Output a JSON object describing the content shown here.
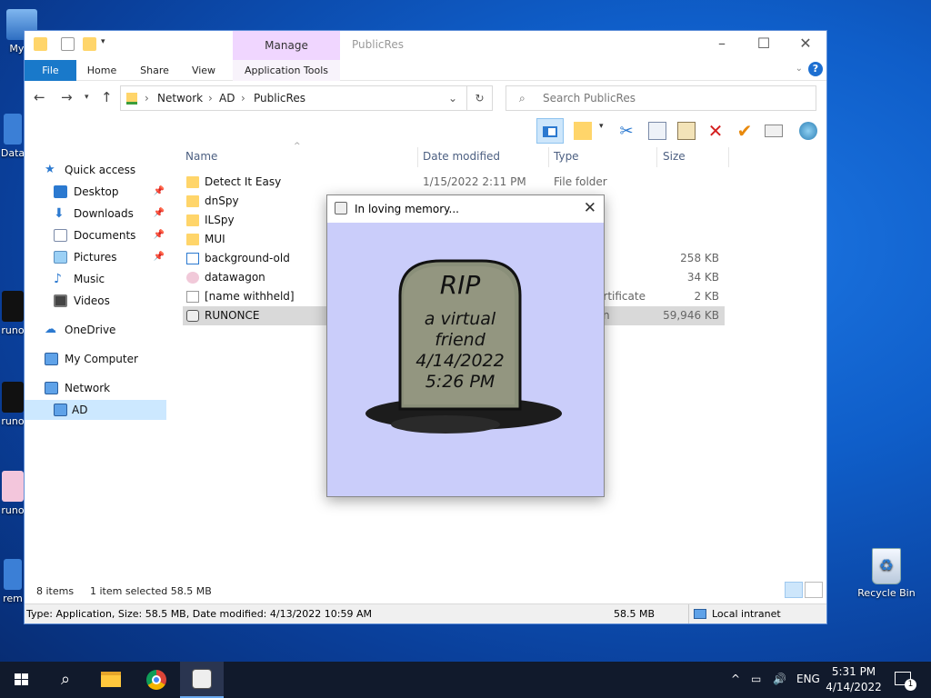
{
  "desktop": {
    "icons": [
      {
        "label": "My C"
      },
      {
        "label": "Data"
      },
      {
        "label": "runo"
      },
      {
        "label": "runo"
      },
      {
        "label": "runo"
      },
      {
        "label": "rem"
      },
      {
        "label": "Recycle Bin"
      }
    ]
  },
  "explorer": {
    "title": "PublicRes",
    "context_tab": "Manage",
    "tabs": [
      "File",
      "Home",
      "Share",
      "View",
      "Application Tools"
    ],
    "address": [
      "Network",
      "AD",
      "PublicRes"
    ],
    "search_placeholder": "Search PublicRes",
    "nav": {
      "quick_access": "Quick access",
      "pinned": [
        "Desktop",
        "Downloads",
        "Documents",
        "Pictures"
      ],
      "unpinned": [
        "Music",
        "Videos"
      ],
      "onedrive": "OneDrive",
      "my_computer": "My Computer",
      "network": "Network",
      "ad": "AD"
    },
    "columns": {
      "name": "Name",
      "date": "Date modified",
      "type": "Type",
      "size": "Size"
    },
    "files": [
      {
        "name": "Detect It Easy",
        "date": "1/15/2022 2:11 PM",
        "type": "File folder",
        "size": ""
      },
      {
        "name": "dnSpy",
        "date": "",
        "type": "",
        "size": ""
      },
      {
        "name": "ILSpy",
        "date": "",
        "type": "",
        "size": ""
      },
      {
        "name": "MUI",
        "date": "",
        "type": "",
        "size": ""
      },
      {
        "name": "background-old",
        "date": "",
        "type": "",
        "size": "258 KB"
      },
      {
        "name": "datawagon",
        "date": "",
        "type": "",
        "size": "34 KB"
      },
      {
        "name": "[name withheld]",
        "date": "",
        "type": "ertificate",
        "size": "2 KB"
      },
      {
        "name": "RUNONCE",
        "date": "",
        "type": "n",
        "size": "59,946 KB"
      }
    ],
    "status": {
      "count": "8 items",
      "selection": "1 item selected  58.5 MB"
    },
    "details": {
      "text": "Type: Application, Size: 58.5 MB, Date modified: 4/13/2022 10:59 AM",
      "size": "58.5 MB",
      "zone": "Local intranet"
    }
  },
  "dialog": {
    "title": "In loving memory...",
    "stone_lines": [
      "RIP",
      "a virtual",
      "friend",
      "4/14/2022",
      "5:26 PM"
    ]
  },
  "taskbar": {
    "language": "ENG",
    "time": "5:31 PM",
    "date": "4/14/2022",
    "notification_count": "1"
  }
}
